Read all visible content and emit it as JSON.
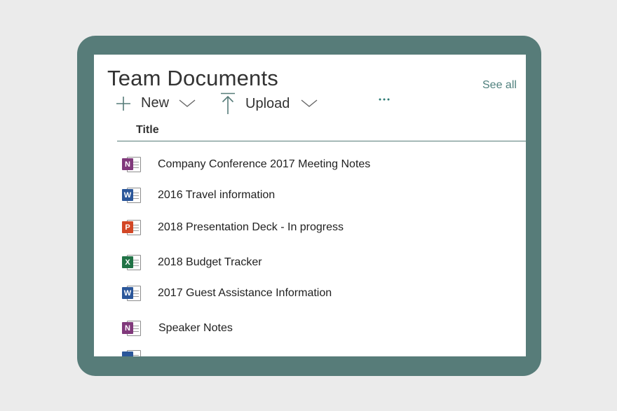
{
  "header": {
    "title": "Team Documents",
    "see_all": "See all"
  },
  "toolbar": {
    "new_label": "New",
    "upload_label": "Upload",
    "more_icon": "ellipsis-icon"
  },
  "list": {
    "column_title": "Title",
    "items": [
      {
        "name": "Company Conference 2017 Meeting Notes",
        "type": "onenote",
        "badge": "N",
        "color": "#80397b"
      },
      {
        "name": "2016 Travel information",
        "type": "word",
        "badge": "W",
        "color": "#2b579a"
      },
      {
        "name": "2018 Presentation Deck - In progress",
        "type": "powerpoint",
        "badge": "P",
        "color": "#d24726"
      },
      {
        "name": "2018 Budget Tracker",
        "type": "excel",
        "badge": "X",
        "color": "#217346"
      },
      {
        "name": "2017 Guest Assistance Information",
        "type": "word",
        "badge": "W",
        "color": "#2b579a"
      },
      {
        "name": "Speaker Notes",
        "type": "onenote",
        "badge": "N",
        "color": "#80397b"
      }
    ]
  },
  "colors": {
    "frame": "#577c79",
    "accent": "#4f807d",
    "background": "#ebebeb"
  }
}
